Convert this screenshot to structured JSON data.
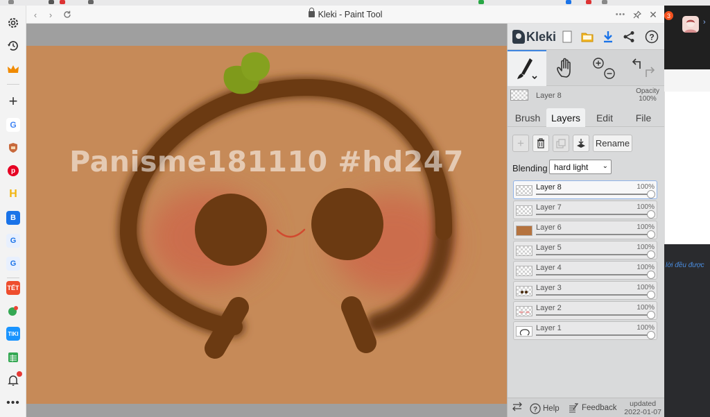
{
  "window": {
    "title": "Kleki - Paint Tool",
    "watermark": "Panisme181110 #hd247"
  },
  "app": {
    "name": "Kleki",
    "current_layer": {
      "name": "Layer 8",
      "opacity_label": "Opacity",
      "opacity_value": "100%"
    },
    "tabs": [
      {
        "label": "Brush"
      },
      {
        "label": "Layers"
      },
      {
        "label": "Edit"
      },
      {
        "label": "File"
      }
    ],
    "rename_label": "Rename",
    "blending_label": "Blending",
    "blending_value": "hard light",
    "layers": [
      {
        "name": "Layer 8",
        "opacity": "100%",
        "opacity_value": 1.0,
        "selected": true,
        "thumb": "blank"
      },
      {
        "name": "Layer 7",
        "opacity": "100%",
        "opacity_value": 1.0,
        "selected": false,
        "thumb": "blank"
      },
      {
        "name": "Layer 6",
        "opacity": "100%",
        "opacity_value": 1.0,
        "selected": false,
        "thumb": "brown"
      },
      {
        "name": "Layer 5",
        "opacity": "100%",
        "opacity_value": 1.0,
        "selected": false,
        "thumb": "blank"
      },
      {
        "name": "Layer 4",
        "opacity": "100%",
        "opacity_value": 1.0,
        "selected": false,
        "thumb": "blank"
      },
      {
        "name": "Layer 3",
        "opacity": "100%",
        "opacity_value": 1.0,
        "selected": false,
        "thumb": "eyes"
      },
      {
        "name": "Layer 2",
        "opacity": "100%",
        "opacity_value": 1.0,
        "selected": false,
        "thumb": "cheeks"
      },
      {
        "name": "Layer 1",
        "opacity": "100%",
        "opacity_value": 1.0,
        "selected": false,
        "thumb": "outline"
      }
    ],
    "footer": {
      "help": "Help",
      "feedback": "Feedback",
      "updated_label": "updated",
      "updated_date": "2022-01-07"
    }
  },
  "background": {
    "badge": "3",
    "snippet": "lời đều được"
  },
  "colors": {
    "canvas": "#c68a58",
    "brown": "#6b3a12",
    "cheek": "#c96a4d",
    "leaf": "#7f9a1b",
    "mouth": "#d14a2f",
    "accent": "#3f86e0"
  }
}
